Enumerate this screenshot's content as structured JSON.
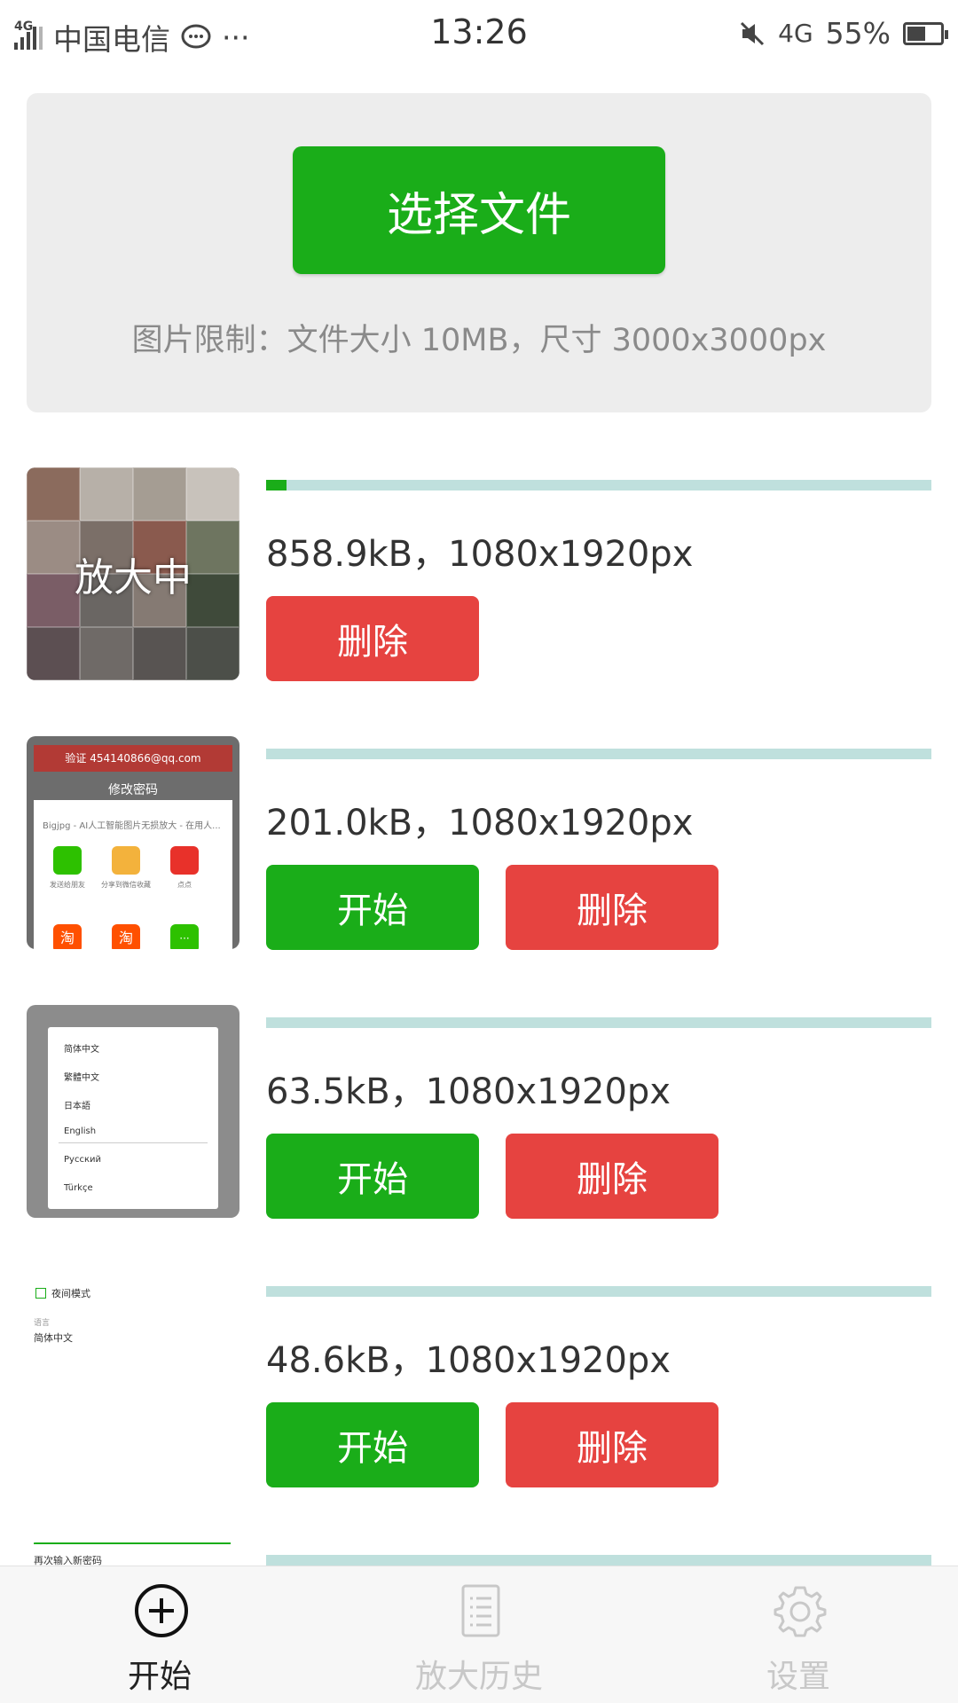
{
  "status_bar": {
    "network_tag": "4G",
    "carrier": "中国电信",
    "more": "···",
    "time": "13:26",
    "signal_type": "4G",
    "battery": "55%",
    "battery_level": 0.55,
    "icons": [
      "signal-icon",
      "message-icon",
      "mute-icon",
      "battery-charging-icon"
    ]
  },
  "upload": {
    "choose_button": "选择文件",
    "limit_text": "图片限制：文件大小 10MB，尺寸 3000x3000px"
  },
  "files": [
    {
      "info": "858.9kB，1080x1920px",
      "status_label": "放大中",
      "progress": 0.03,
      "actions": [
        "删除"
      ]
    },
    {
      "info": "201.0kB，1080x1920px",
      "progress": 0,
      "actions": [
        "开始",
        "删除"
      ],
      "thumb_text": {
        "bar": "验证 454140866@qq.com",
        "heading": "修改密码",
        "sheet_title": "Bigjpg - AI人工智能图片无损放大 - 在用人...",
        "apps": [
          "发送给朋友",
          "分享到微信收藏",
          "点点",
          "淘",
          "淘",
          "···"
        ]
      }
    },
    {
      "info": "63.5kB，1080x1920px",
      "progress": 0,
      "actions": [
        "开始",
        "删除"
      ],
      "thumb_text": {
        "languages": [
          "简体中文",
          "繁體中文",
          "日本語",
          "English",
          "Русский",
          "Türkçe"
        ]
      }
    },
    {
      "info": "48.6kB，1080x1920px",
      "progress": 0,
      "actions": [
        "开始",
        "删除"
      ],
      "thumb_text": {
        "night_mode": "夜间模式",
        "language_label": "语言",
        "language_value": "简体中文"
      }
    },
    {
      "info": "",
      "progress": 0,
      "actions": [],
      "thumb_text": {
        "confirm_label": "再次输入新密码"
      }
    }
  ],
  "tabbar": {
    "tabs": [
      {
        "label": "开始",
        "icon": "add-circle-icon",
        "active": true
      },
      {
        "label": "放大历史",
        "icon": "list-icon",
        "active": false
      },
      {
        "label": "设置",
        "icon": "gear-icon",
        "active": false
      }
    ]
  },
  "colors": {
    "primary_green": "#1aad19",
    "danger_red": "#e64340",
    "progress_track": "#bfe0dd",
    "panel_bg": "#ededed"
  }
}
